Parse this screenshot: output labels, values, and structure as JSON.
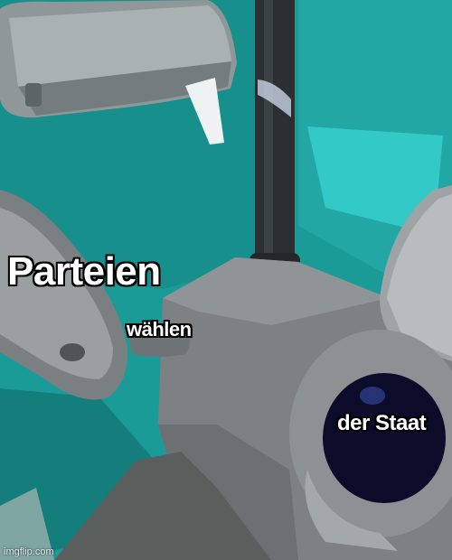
{
  "meme": {
    "label_top_left": "Parteien",
    "label_middle": "wählen",
    "label_right": "der Staat"
  },
  "watermark": "imgflip.com",
  "colors": {
    "wall_teal": "#1a9a97",
    "fixture_gray": "#7d8183",
    "pipe_dark": "#2b2f31",
    "hole_dark": "#0a0c2a"
  }
}
